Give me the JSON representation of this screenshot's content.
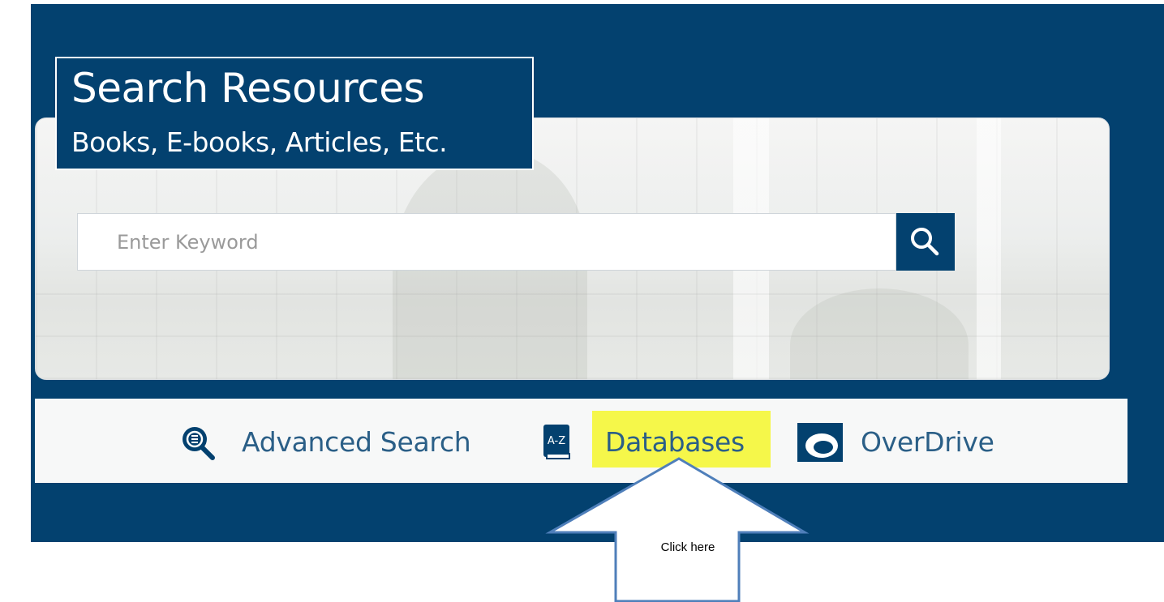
{
  "colors": {
    "brand_navy": "#03416f",
    "link_text": "#2b5f87",
    "highlight_yellow": "#f5f74a",
    "arrow_outline": "#4f7fba"
  },
  "header": {
    "title": "Search Resources",
    "subtitle": "Books, E-books, Articles, Etc."
  },
  "search": {
    "placeholder": "Enter Keyword",
    "value": "",
    "button_icon": "magnifier-icon"
  },
  "links": [
    {
      "label": "Advanced Search",
      "icon": "advanced-search-magnifier-icon"
    },
    {
      "label": "Databases",
      "icon": "a-z-book-icon",
      "highlighted": true
    },
    {
      "label": "OverDrive",
      "icon": "overdrive-logo-icon"
    }
  ],
  "annotation": {
    "callout_text": "Click here",
    "points_to": "Databases"
  }
}
